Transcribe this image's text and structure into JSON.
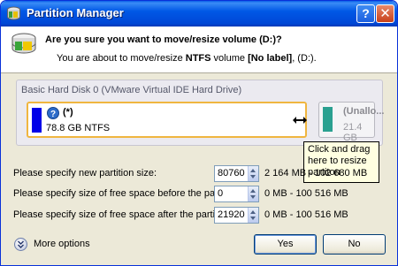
{
  "window": {
    "title": "Partition Manager",
    "help_label": "?",
    "close_label": "✕"
  },
  "header": {
    "question": "Are you sure you want to move/resize volume (D:)?",
    "sub_prefix": "You are about to move/resize ",
    "sub_fs": "NTFS",
    "sub_mid": " volume ",
    "sub_label": "[No label]",
    "sub_suffix": ", (D:)."
  },
  "disk": {
    "title": "Basic Hard Disk 0 (VMware Virtual IDE Hard Drive)",
    "partition": {
      "label": "(*)",
      "size": "78.8 GB NTFS",
      "color": "#0000e8"
    },
    "unallocated": {
      "label": "(Unallo...",
      "size": "21.4 GB",
      "color": "#2aa090"
    }
  },
  "tooltip": {
    "text": "Click and drag here to resize partiton"
  },
  "fields": [
    {
      "label": "Please specify new partition size:",
      "value": "80760",
      "hint": "2 164 MB - 102 680 MB"
    },
    {
      "label": "Please specify size of free space before the partition:",
      "value": "0",
      "hint": "0 MB - 100 516 MB"
    },
    {
      "label": "Please specify size of free space after the partition:",
      "value": "21920",
      "hint": "0 MB - 100 516 MB"
    }
  ],
  "footer": {
    "more_options": "More options",
    "yes_label": "Yes",
    "no_label": "No"
  }
}
